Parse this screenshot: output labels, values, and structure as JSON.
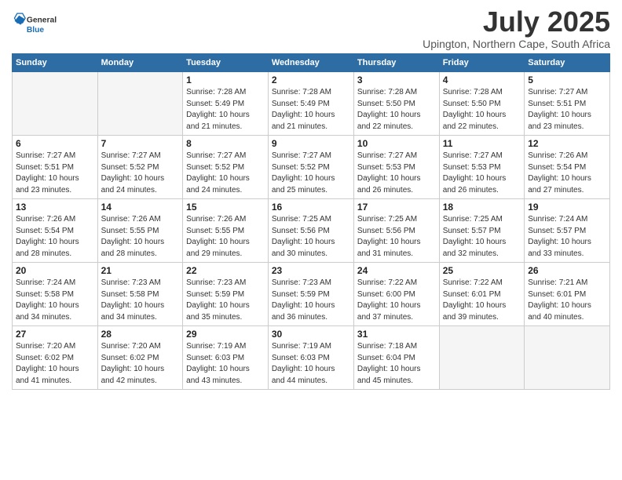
{
  "logo": {
    "general": "General",
    "blue": "Blue"
  },
  "header": {
    "month_year": "July 2025",
    "location": "Upington, Northern Cape, South Africa"
  },
  "weekdays": [
    "Sunday",
    "Monday",
    "Tuesday",
    "Wednesday",
    "Thursday",
    "Friday",
    "Saturday"
  ],
  "weeks": [
    [
      {
        "day": "",
        "empty": true
      },
      {
        "day": "",
        "empty": true
      },
      {
        "day": "1",
        "sunrise": "Sunrise: 7:28 AM",
        "sunset": "Sunset: 5:49 PM",
        "daylight": "Daylight: 10 hours and 21 minutes."
      },
      {
        "day": "2",
        "sunrise": "Sunrise: 7:28 AM",
        "sunset": "Sunset: 5:49 PM",
        "daylight": "Daylight: 10 hours and 21 minutes."
      },
      {
        "day": "3",
        "sunrise": "Sunrise: 7:28 AM",
        "sunset": "Sunset: 5:50 PM",
        "daylight": "Daylight: 10 hours and 22 minutes."
      },
      {
        "day": "4",
        "sunrise": "Sunrise: 7:28 AM",
        "sunset": "Sunset: 5:50 PM",
        "daylight": "Daylight: 10 hours and 22 minutes."
      },
      {
        "day": "5",
        "sunrise": "Sunrise: 7:27 AM",
        "sunset": "Sunset: 5:51 PM",
        "daylight": "Daylight: 10 hours and 23 minutes."
      }
    ],
    [
      {
        "day": "6",
        "sunrise": "Sunrise: 7:27 AM",
        "sunset": "Sunset: 5:51 PM",
        "daylight": "Daylight: 10 hours and 23 minutes."
      },
      {
        "day": "7",
        "sunrise": "Sunrise: 7:27 AM",
        "sunset": "Sunset: 5:52 PM",
        "daylight": "Daylight: 10 hours and 24 minutes."
      },
      {
        "day": "8",
        "sunrise": "Sunrise: 7:27 AM",
        "sunset": "Sunset: 5:52 PM",
        "daylight": "Daylight: 10 hours and 24 minutes."
      },
      {
        "day": "9",
        "sunrise": "Sunrise: 7:27 AM",
        "sunset": "Sunset: 5:52 PM",
        "daylight": "Daylight: 10 hours and 25 minutes."
      },
      {
        "day": "10",
        "sunrise": "Sunrise: 7:27 AM",
        "sunset": "Sunset: 5:53 PM",
        "daylight": "Daylight: 10 hours and 26 minutes."
      },
      {
        "day": "11",
        "sunrise": "Sunrise: 7:27 AM",
        "sunset": "Sunset: 5:53 PM",
        "daylight": "Daylight: 10 hours and 26 minutes."
      },
      {
        "day": "12",
        "sunrise": "Sunrise: 7:26 AM",
        "sunset": "Sunset: 5:54 PM",
        "daylight": "Daylight: 10 hours and 27 minutes."
      }
    ],
    [
      {
        "day": "13",
        "sunrise": "Sunrise: 7:26 AM",
        "sunset": "Sunset: 5:54 PM",
        "daylight": "Daylight: 10 hours and 28 minutes."
      },
      {
        "day": "14",
        "sunrise": "Sunrise: 7:26 AM",
        "sunset": "Sunset: 5:55 PM",
        "daylight": "Daylight: 10 hours and 28 minutes."
      },
      {
        "day": "15",
        "sunrise": "Sunrise: 7:26 AM",
        "sunset": "Sunset: 5:55 PM",
        "daylight": "Daylight: 10 hours and 29 minutes."
      },
      {
        "day": "16",
        "sunrise": "Sunrise: 7:25 AM",
        "sunset": "Sunset: 5:56 PM",
        "daylight": "Daylight: 10 hours and 30 minutes."
      },
      {
        "day": "17",
        "sunrise": "Sunrise: 7:25 AM",
        "sunset": "Sunset: 5:56 PM",
        "daylight": "Daylight: 10 hours and 31 minutes."
      },
      {
        "day": "18",
        "sunrise": "Sunrise: 7:25 AM",
        "sunset": "Sunset: 5:57 PM",
        "daylight": "Daylight: 10 hours and 32 minutes."
      },
      {
        "day": "19",
        "sunrise": "Sunrise: 7:24 AM",
        "sunset": "Sunset: 5:57 PM",
        "daylight": "Daylight: 10 hours and 33 minutes."
      }
    ],
    [
      {
        "day": "20",
        "sunrise": "Sunrise: 7:24 AM",
        "sunset": "Sunset: 5:58 PM",
        "daylight": "Daylight: 10 hours and 34 minutes."
      },
      {
        "day": "21",
        "sunrise": "Sunrise: 7:23 AM",
        "sunset": "Sunset: 5:58 PM",
        "daylight": "Daylight: 10 hours and 34 minutes."
      },
      {
        "day": "22",
        "sunrise": "Sunrise: 7:23 AM",
        "sunset": "Sunset: 5:59 PM",
        "daylight": "Daylight: 10 hours and 35 minutes."
      },
      {
        "day": "23",
        "sunrise": "Sunrise: 7:23 AM",
        "sunset": "Sunset: 5:59 PM",
        "daylight": "Daylight: 10 hours and 36 minutes."
      },
      {
        "day": "24",
        "sunrise": "Sunrise: 7:22 AM",
        "sunset": "Sunset: 6:00 PM",
        "daylight": "Daylight: 10 hours and 37 minutes."
      },
      {
        "day": "25",
        "sunrise": "Sunrise: 7:22 AM",
        "sunset": "Sunset: 6:01 PM",
        "daylight": "Daylight: 10 hours and 39 minutes."
      },
      {
        "day": "26",
        "sunrise": "Sunrise: 7:21 AM",
        "sunset": "Sunset: 6:01 PM",
        "daylight": "Daylight: 10 hours and 40 minutes."
      }
    ],
    [
      {
        "day": "27",
        "sunrise": "Sunrise: 7:20 AM",
        "sunset": "Sunset: 6:02 PM",
        "daylight": "Daylight: 10 hours and 41 minutes."
      },
      {
        "day": "28",
        "sunrise": "Sunrise: 7:20 AM",
        "sunset": "Sunset: 6:02 PM",
        "daylight": "Daylight: 10 hours and 42 minutes."
      },
      {
        "day": "29",
        "sunrise": "Sunrise: 7:19 AM",
        "sunset": "Sunset: 6:03 PM",
        "daylight": "Daylight: 10 hours and 43 minutes."
      },
      {
        "day": "30",
        "sunrise": "Sunrise: 7:19 AM",
        "sunset": "Sunset: 6:03 PM",
        "daylight": "Daylight: 10 hours and 44 minutes."
      },
      {
        "day": "31",
        "sunrise": "Sunrise: 7:18 AM",
        "sunset": "Sunset: 6:04 PM",
        "daylight": "Daylight: 10 hours and 45 minutes."
      },
      {
        "day": "",
        "empty": true
      },
      {
        "day": "",
        "empty": true
      }
    ]
  ]
}
